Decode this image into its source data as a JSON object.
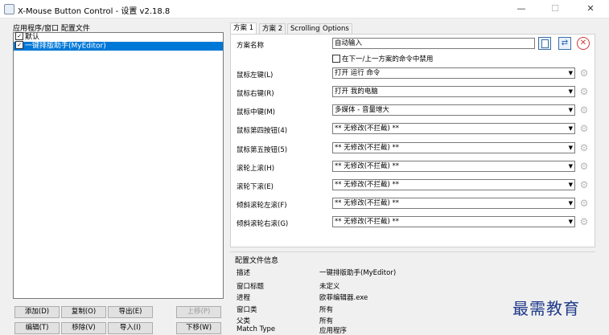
{
  "window": {
    "title": "X-Mouse Button Control - 设置 v2.18.8",
    "controls": {
      "minimize": "—",
      "maximize": "☐",
      "close": "✕"
    }
  },
  "left_panel": {
    "group_title": "应用程序/窗口 配置文件",
    "items": [
      {
        "label": "默认",
        "checked": true,
        "selected": false
      },
      {
        "label": "一键排版助手(MyEditor)",
        "checked": true,
        "selected": true
      }
    ],
    "buttons": {
      "add": "添加(D)",
      "copy": "复制(O)",
      "export": "导出(E)",
      "move_up": "上移(P)",
      "edit": "编辑(T)",
      "remove": "移除(V)",
      "import": "导入(I)",
      "move_down": "下移(W)"
    }
  },
  "tabs": [
    {
      "label": "方案 1",
      "active": true
    },
    {
      "label": "方案 2",
      "active": false
    },
    {
      "label": "Scrolling",
      "active": false
    },
    {
      "label": "Options",
      "active": false
    }
  ],
  "scheme": {
    "name_label": "方案名称",
    "name_value": "自动输入",
    "disable_checkbox_label": "在下一/上一方案的命令中禁用",
    "rows": [
      {
        "label": "鼠标左键(L)",
        "value": "打开 运行 命令"
      },
      {
        "label": "鼠标右键(R)",
        "value": "打开 我的电脑"
      },
      {
        "label": "鼠标中键(M)",
        "value": "多媒体 - 音量增大"
      },
      {
        "label": "鼠标第四按钮(4)",
        "value": "** 无修改(不拦截) **"
      },
      {
        "label": "鼠标第五按钮(5)",
        "value": "** 无修改(不拦截) **"
      },
      {
        "label": "滚轮上滚(H)",
        "value": "** 无修改(不拦截) **"
      },
      {
        "label": "滚轮下滚(E)",
        "value": "** 无修改(不拦截) **"
      },
      {
        "label": "倾斜滚轮左滚(F)",
        "value": "** 无修改(不拦截) **"
      },
      {
        "label": "倾斜滚轮右滚(G)",
        "value": "** 无修改(不拦截) **"
      }
    ]
  },
  "profile_info": {
    "title": "配置文件信息",
    "rows": [
      {
        "label": "描述",
        "value": "一键排版助手(MyEditor)"
      },
      {
        "label": "窗口标题",
        "value": "未定义"
      },
      {
        "label": "进程",
        "value": "欧菲编辑器.exe"
      },
      {
        "label": "窗口类",
        "value": "所有"
      },
      {
        "label": "父类",
        "value": "所有"
      },
      {
        "label": "Match Type",
        "value": "应用程序"
      }
    ]
  },
  "watermark": "最需教育"
}
